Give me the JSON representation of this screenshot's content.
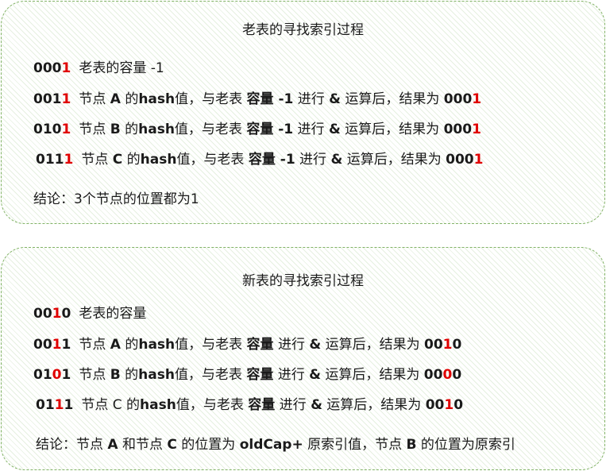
{
  "old_panel": {
    "title": "老表的寻找索引过程",
    "rows": [
      {
        "code_pre": "000",
        "code_hl": "1",
        "code_post": "",
        "plain": "老表的容量 -1"
      },
      {
        "code_pre": "001",
        "code_hl": "1",
        "code_post": "",
        "t1": "节点 ",
        "node": "A",
        "t2": " 的",
        "hash": "hash",
        "t3": "值，与老表 ",
        "cap": "容量 -1",
        "t4": " 进行 ",
        "amp": "&",
        "t5": " 运算后，结果为 ",
        "res_pre": "000",
        "res_hl": "1",
        "res_post": ""
      },
      {
        "code_pre": "010",
        "code_hl": "1",
        "code_post": "",
        "t1": "节点 ",
        "node": "B",
        "t2": " 的",
        "hash": "hash",
        "t3": "值，与老表 ",
        "cap": "容量 -1",
        "t4": " 进行 ",
        "amp": "&",
        "t5": " 运算后，结果为 ",
        "res_pre": "000",
        "res_hl": "1",
        "res_post": ""
      },
      {
        "code_pre": "011",
        "code_hl": "1",
        "code_post": "",
        "t1": "节点 ",
        "node": "C",
        "t2": " 的",
        "hash": "hash",
        "t3": "值，与老表 ",
        "cap": "容量 -1",
        "t4": " 进行 ",
        "amp": "&",
        "t5": " 运算后，结果为 ",
        "res_pre": "000",
        "res_hl": "1",
        "res_post": ""
      }
    ],
    "conclusion": "结论：3个节点的位置都为1"
  },
  "new_panel": {
    "title": "新表的寻找索引过程",
    "rows": [
      {
        "code_pre": "00",
        "code_hl": "1",
        "code_post": "0",
        "plain": "老表的容量"
      },
      {
        "code_pre": "00",
        "code_hl": "1",
        "code_post": "1",
        "t1": "节点 ",
        "node": "A",
        "t2": " 的",
        "hash": "hash",
        "t3": "值，与老表 ",
        "cap": "容量",
        "t4": " 进行 ",
        "amp": "&",
        "t5": " 运算后，结果为 ",
        "res_pre": "00",
        "res_hl": "1",
        "res_post": "0"
      },
      {
        "code_pre": "01",
        "code_hl": "0",
        "code_post": "1",
        "t1": "节点 ",
        "node": "B",
        "t2": " 的",
        "hash": "hash",
        "t3": "值，与老表 ",
        "cap": "容量",
        "t4": " 进行 ",
        "amp": "&",
        "t5": " 运算后，结果为 ",
        "res_pre": "00",
        "res_hl": "0",
        "res_post": "0"
      },
      {
        "code_pre": "01",
        "code_hl": "1",
        "code_post": "1",
        "t1": "节点 C 的",
        "hash": "hash",
        "t3": "值，与老表 ",
        "cap": "容量",
        "t4": " 进行 ",
        "amp": "&",
        "t5": " 运算后，结果为 ",
        "res_pre": "00",
        "res_hl": "1",
        "res_post": "0"
      }
    ],
    "conclusion": {
      "c1": "结论：节点 ",
      "a": "A",
      "c2": " 和节点 ",
      "c": "C",
      "c3": " 的位置为 ",
      "oldcap": "oldCap+",
      "c4": " 原索引值，节点 ",
      "b": "B",
      "c5": " 的位置为原索引"
    }
  }
}
